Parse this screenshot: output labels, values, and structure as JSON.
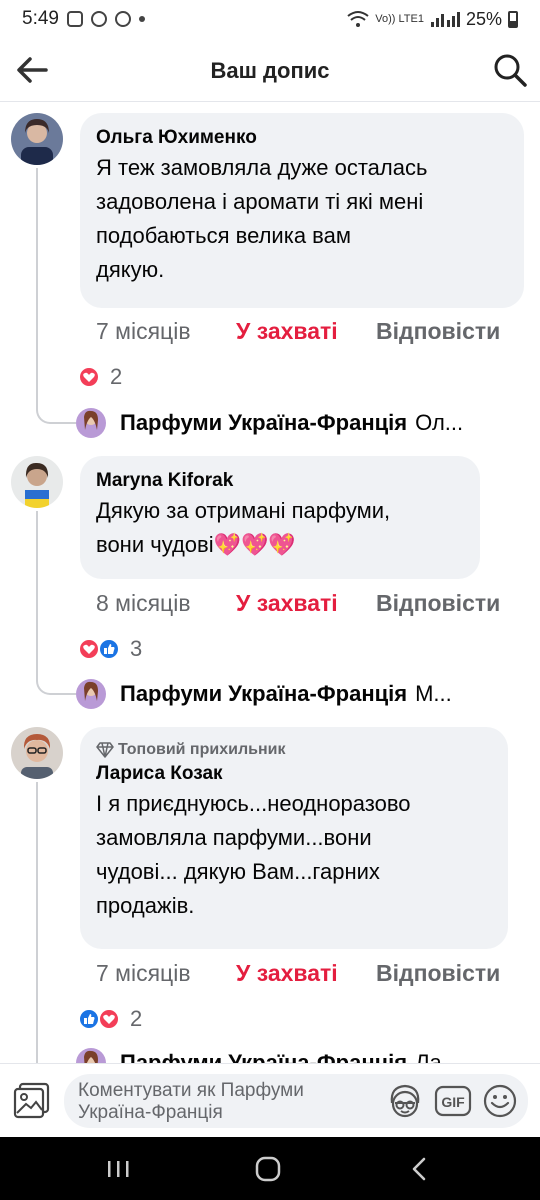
{
  "status_bar": {
    "time": "5:49",
    "network_label": "Vo)) LTE1",
    "battery": "25%"
  },
  "header": {
    "title": "Ваш допис"
  },
  "comments": [
    {
      "author": "Ольга Юхименко",
      "lines": [
        "Я теж замовляла дуже осталась",
        "задоволена і аромати ті які мені",
        "подобаються велика вам",
        "дякую."
      ],
      "time": "7 місяців",
      "reaction_label": "У захваті",
      "reply_label": "Відповісти",
      "reaction_count": "2",
      "reply_author": "Парфуми Україна-Франція",
      "reply_preview": "Ол..."
    },
    {
      "author": "Maryna Kiforak",
      "lines": [
        "Дякую за отримані парфуми,",
        "вони чудові💖💖💖"
      ],
      "time": "8 місяців",
      "reaction_label": "У захваті",
      "reply_label": "Відповісти",
      "reaction_count": "3",
      "reply_author": "Парфуми Україна-Франція",
      "reply_preview": "М..."
    },
    {
      "badge": "Топовий прихильник",
      "author": "Лариса Козак",
      "lines": [
        "І я приєднуюсь...неодноразово",
        "замовляла парфуми...вони",
        "чудові... дякую Вам...гарних",
        "продажів."
      ],
      "time": "7 місяців",
      "reaction_label": "У захваті",
      "reply_label": "Відповісти",
      "reaction_count": "2",
      "reply_author": "Парфуми Україна-Франція",
      "reply_preview": "Ла..."
    }
  ],
  "composer": {
    "placeholder_line1": "Коментувати як Парфуми",
    "placeholder_line2": "Україна-Франція",
    "gif_label": "GIF"
  },
  "colors": {
    "accent_reaction": "#e41e3f",
    "bubble": "#f0f2f5",
    "muted": "#65676b",
    "like_blue": "#1b74e4",
    "love_red": "#f33e58"
  }
}
